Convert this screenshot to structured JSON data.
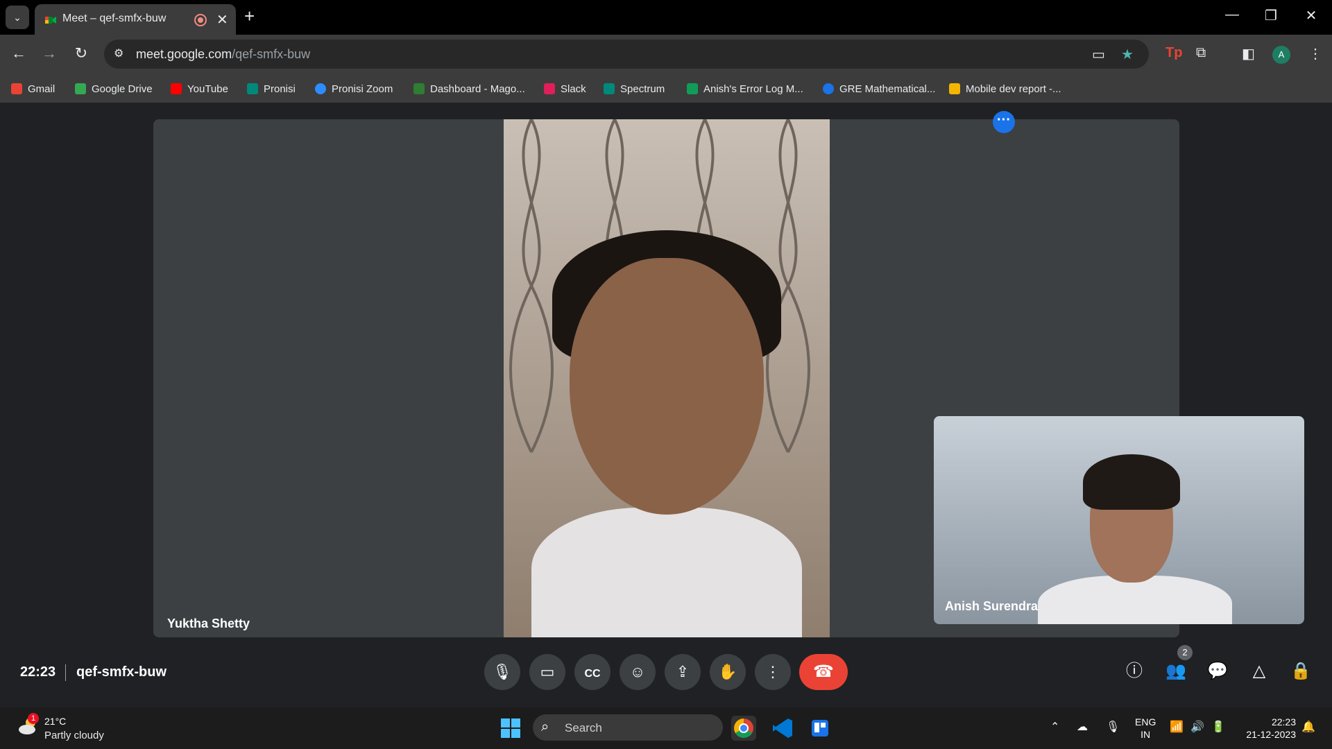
{
  "browser": {
    "tab_title": "Meet – qef-smfx-buw",
    "url_host": "meet.google.com",
    "url_path": "/qef-smfx-buw",
    "profile_initial": "A"
  },
  "bookmarks": [
    {
      "label": "Gmail",
      "color": "#ea4335"
    },
    {
      "label": "Google Drive",
      "color": "#34a853"
    },
    {
      "label": "YouTube",
      "color": "#ff0000"
    },
    {
      "label": "Pronisi",
      "color": "#00897b"
    },
    {
      "label": "Pronisi Zoom",
      "color": "#2d8cff"
    },
    {
      "label": "Dashboard - Mago...",
      "color": "#2e7d32"
    },
    {
      "label": "Slack",
      "color": "#e01e5a"
    },
    {
      "label": "Spectrum",
      "color": "#00897b"
    },
    {
      "label": "Anish's Error Log M...",
      "color": "#0f9d58"
    },
    {
      "label": "GRE Mathematical...",
      "color": "#1a73e8"
    },
    {
      "label": "Mobile dev report -...",
      "color": "#f4b400"
    }
  ],
  "meet": {
    "main_participant": "Yuktha Shetty",
    "self_participant": "Anish Surendra",
    "clock": "22:23",
    "meeting_code": "qef-smfx-buw",
    "participant_count": "2",
    "end_call_color": "#ea4335",
    "accent_color": "#1a73e8"
  },
  "taskbar": {
    "weather_temp": "21°C",
    "weather_desc": "Partly cloudy",
    "weather_badge": "1",
    "search_placeholder": "Search",
    "lang_1": "ENG",
    "lang_2": "IN",
    "time": "22:23",
    "date": "21-12-2023"
  }
}
